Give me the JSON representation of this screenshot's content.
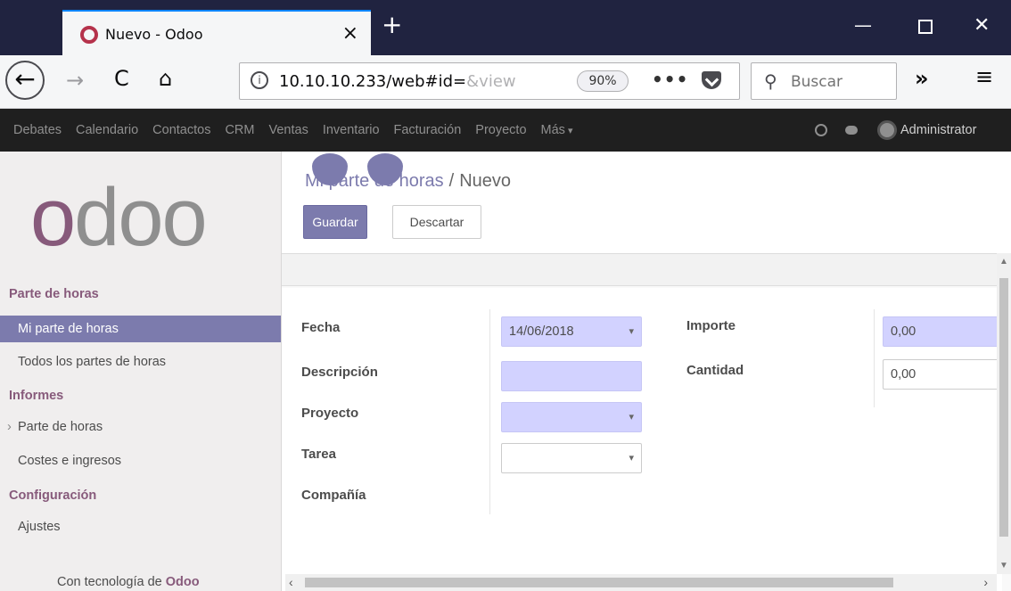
{
  "browser": {
    "tab_title": "Nuevo - Odoo",
    "tab_close": "×",
    "new_tab": "+",
    "window_minimize": "—",
    "window_close": "✕",
    "back": "←",
    "forward": "→",
    "reload": "C",
    "home": "⌂",
    "url_info": "i",
    "url_main": "10.10.10.233/web#id=",
    "url_faded": "&view",
    "zoom": "90%",
    "url_more": "•••",
    "search_placeholder": "Buscar",
    "search_glyph": "⚲",
    "overflow": "»",
    "menu": "≡"
  },
  "odoo_nav": {
    "apps": [
      "Debates",
      "Calendario",
      "Contactos",
      "CRM",
      "Ventas",
      "Inventario",
      "Facturación",
      "Proyecto",
      "Más"
    ],
    "user": "Administrator"
  },
  "sidebar": {
    "logo_first": "o",
    "logo_rest": "doo",
    "section_timesheets": "Parte de horas",
    "item_my_timesheets": "Mi parte de horas",
    "item_all_timesheets": "Todos los partes de horas",
    "section_reports": "Informes",
    "item_report_timesheets": "Parte de horas",
    "item_costs": "Costes e ingresos",
    "section_config": "Configuración",
    "item_settings": "Ajustes",
    "powered_prefix": "Con tecnología de",
    "powered_brand": "Odoo"
  },
  "control_panel": {
    "breadcrumb_parent": "Mi parte de horas",
    "breadcrumb_sep": "/",
    "breadcrumb_current": "Nuevo",
    "save_label": "Guardar",
    "discard_label": "Descartar"
  },
  "form": {
    "date_label": "Fecha",
    "date_value": "14/06/2018",
    "description_label": "Descripción",
    "description_value": "",
    "project_label": "Proyecto",
    "project_value": "",
    "task_label": "Tarea",
    "task_value": "",
    "company_label": "Compañía",
    "amount_label": "Importe",
    "amount_value": "0,00",
    "quantity_label": "Cantidad",
    "quantity_value": "0,00"
  },
  "scroll": {
    "up": "▲",
    "down": "▼",
    "left": "‹",
    "right": "›"
  },
  "colors": {
    "brand": "#875a7b",
    "accent": "#7c7bad",
    "required_field": "#d2d2ff",
    "topbar": "#1f1f1f"
  }
}
